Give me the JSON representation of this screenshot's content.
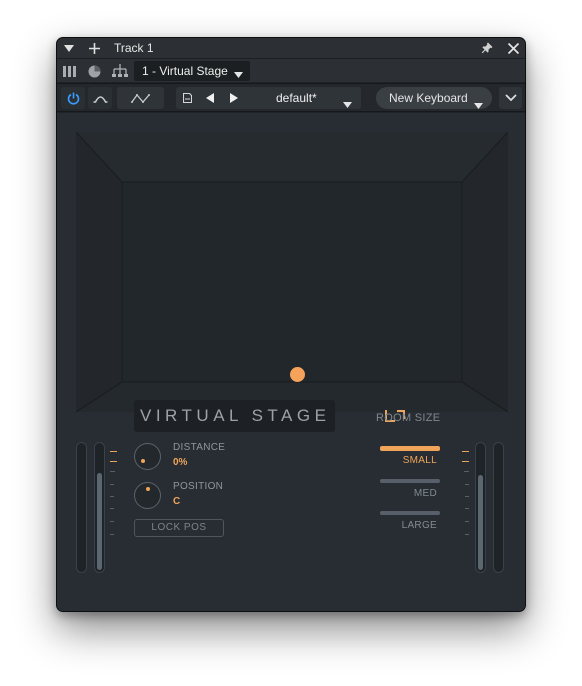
{
  "window": {
    "title": "Track 1"
  },
  "row2": {
    "plugin_selector": "1 - Virtual Stage"
  },
  "toolbar": {
    "preset_name": "default*",
    "keyboard_selector": "New Keyboard"
  },
  "stage": {
    "source_position": {
      "distance_percent": 0,
      "pan": "C"
    },
    "source_color": "#f5a35b"
  },
  "panel": {
    "plugin_title": "VIRTUAL STAGE",
    "distance": {
      "label": "DISTANCE",
      "value": "0%"
    },
    "position": {
      "label": "POSITION",
      "value": "C"
    },
    "lock_pos_label": "LOCK POS",
    "room_size": {
      "title": "ROOM SIZE",
      "options": [
        "SMALL",
        "MED",
        "LARGE"
      ],
      "selected": "SMALL"
    },
    "meters": {
      "left_level": 0.77,
      "right_level": 0.75
    }
  },
  "colors": {
    "accent": "#f0a45a",
    "power_active": "#3b9cff",
    "background": "#1f2327"
  },
  "icons": {
    "collapse": "triangle-down-icon",
    "add": "plus-icon",
    "pin": "pin-icon",
    "close": "close-icon",
    "routing": "routing-icon",
    "power": "power-icon",
    "automation": "automation-icon",
    "envelope": "envelope-icon",
    "save": "save-icon",
    "prev": "prev-arrow-icon",
    "next": "next-arrow-icon",
    "expand": "chevron-down-icon"
  }
}
